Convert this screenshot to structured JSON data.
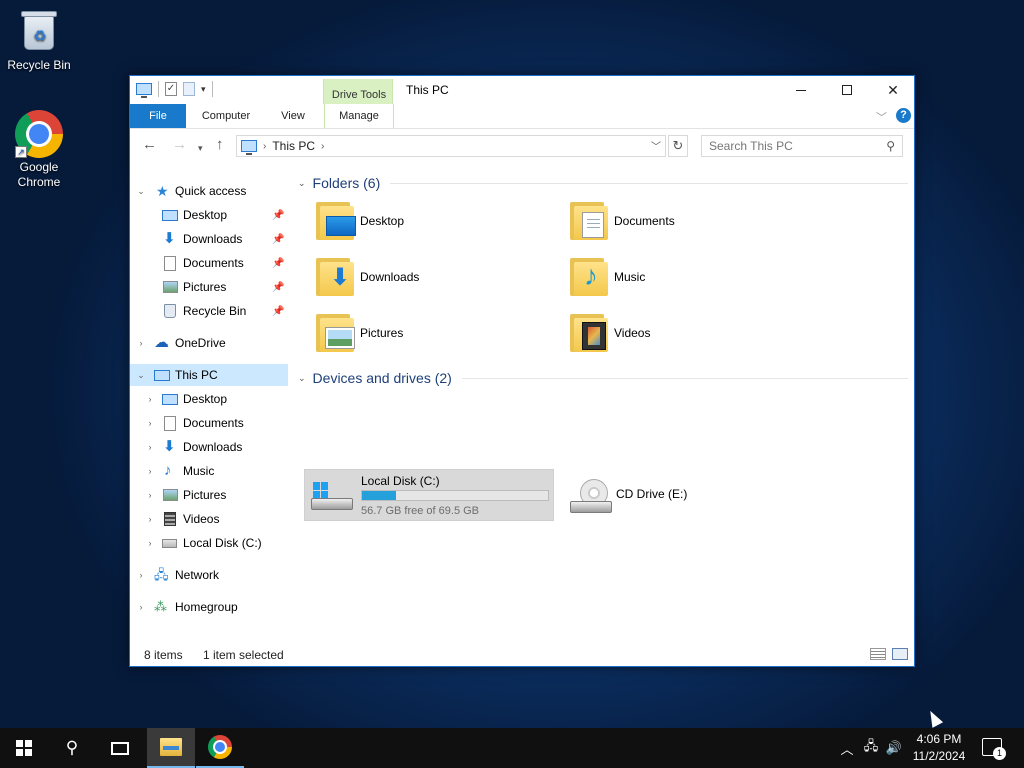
{
  "desktop": {
    "icons": [
      {
        "label": "Recycle Bin"
      },
      {
        "label": "Google Chrome"
      }
    ]
  },
  "window": {
    "title": "This PC",
    "context_tab_group": "Drive Tools",
    "ribbon_tabs": [
      "File",
      "Computer",
      "View",
      "Manage"
    ],
    "address": {
      "location": "This PC"
    },
    "search": {
      "placeholder": "Search This PC"
    },
    "nav": {
      "quick_access": "Quick access",
      "quick_items": [
        "Desktop",
        "Downloads",
        "Documents",
        "Pictures",
        "Recycle Bin"
      ],
      "onedrive": "OneDrive",
      "this_pc": "This PC",
      "pc_items": [
        "Desktop",
        "Documents",
        "Downloads",
        "Music",
        "Pictures",
        "Videos",
        "Local Disk (C:)"
      ],
      "network": "Network",
      "homegroup": "Homegroup"
    },
    "folders_group": "Folders (6)",
    "folders": [
      "Desktop",
      "Documents",
      "Downloads",
      "Music",
      "Pictures",
      "Videos"
    ],
    "devices_group": "Devices and drives (2)",
    "drives": [
      {
        "name": "Local Disk (C:)",
        "free_text": "56.7 GB free of 69.5 GB",
        "used_fraction": 0.184,
        "selected": true
      },
      {
        "name": "CD Drive (E:)"
      }
    ],
    "status": {
      "items": "8 items",
      "selected": "1 item selected"
    }
  },
  "taskbar": {
    "time": "4:06 PM",
    "date": "11/2/2024",
    "notification_count": "1"
  },
  "colors": {
    "accent": "#1979ca",
    "selection": "#cce8ff",
    "drive_tools": "#d8f0c2",
    "progress": "#26a0da"
  }
}
